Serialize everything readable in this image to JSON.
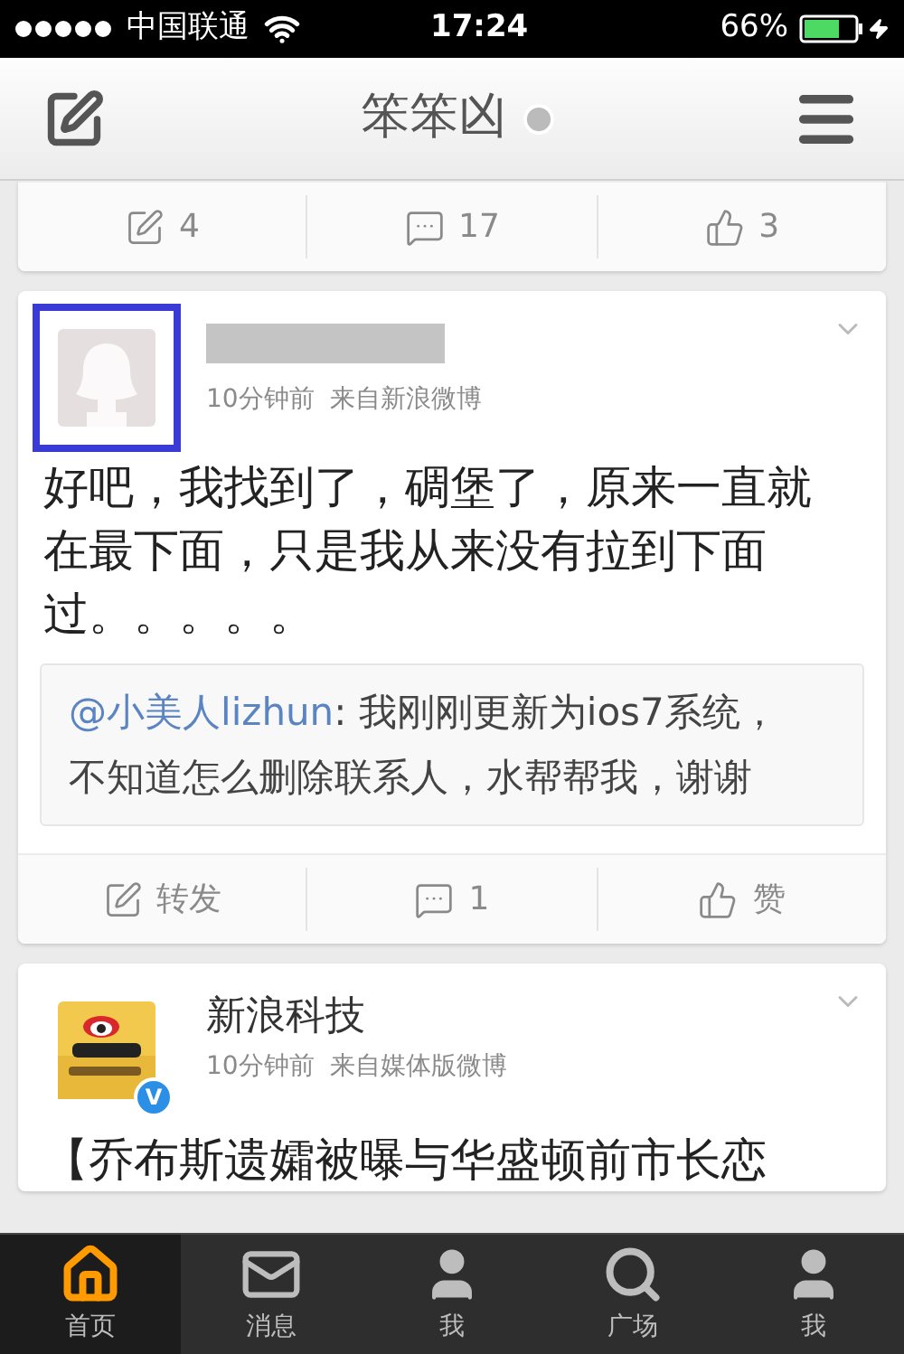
{
  "status_bar": {
    "carrier": "中国联通",
    "time": "17:24",
    "battery": "66%"
  },
  "nav": {
    "title": "笨笨凶"
  },
  "partial_post": {
    "actions": [
      {
        "kind": "repost",
        "label": "4"
      },
      {
        "kind": "comment",
        "label": "17"
      },
      {
        "kind": "like",
        "label": "3"
      }
    ]
  },
  "posts": [
    {
      "avatar": {
        "kind": "placeholder"
      },
      "highlighted": true,
      "name_redacted": true,
      "meta": "10分钟前  来自新浪微博",
      "text": "好吧，我找到了，碉堡了，原来一直就在最下面，只是我从来没有拉到下面过。。。。。",
      "quote": {
        "mention": "@小美人lizhun",
        "text": ": 我刚刚更新为ios7系统，不知道怎么删除联系人，水帮帮我，谢谢"
      },
      "actions": [
        {
          "kind": "repost",
          "label": "转发"
        },
        {
          "kind": "comment",
          "label": "1"
        },
        {
          "kind": "like",
          "label": "赞"
        }
      ]
    },
    {
      "avatar": {
        "kind": "logo"
      },
      "highlighted": false,
      "name": "新浪科技",
      "verified": "V",
      "meta": "10分钟前  来自媒体版微博",
      "text": "【乔布斯遗孀被曝与华盛顿前市长恋"
    }
  ],
  "tab_bar": [
    {
      "kind": "home",
      "label": "首页",
      "selected": true
    },
    {
      "kind": "mail",
      "label": "消息",
      "selected": false
    },
    {
      "kind": "person",
      "label": "我",
      "selected": false
    },
    {
      "kind": "search",
      "label": "广场",
      "selected": false
    },
    {
      "kind": "person",
      "label": "我",
      "selected": false
    }
  ]
}
